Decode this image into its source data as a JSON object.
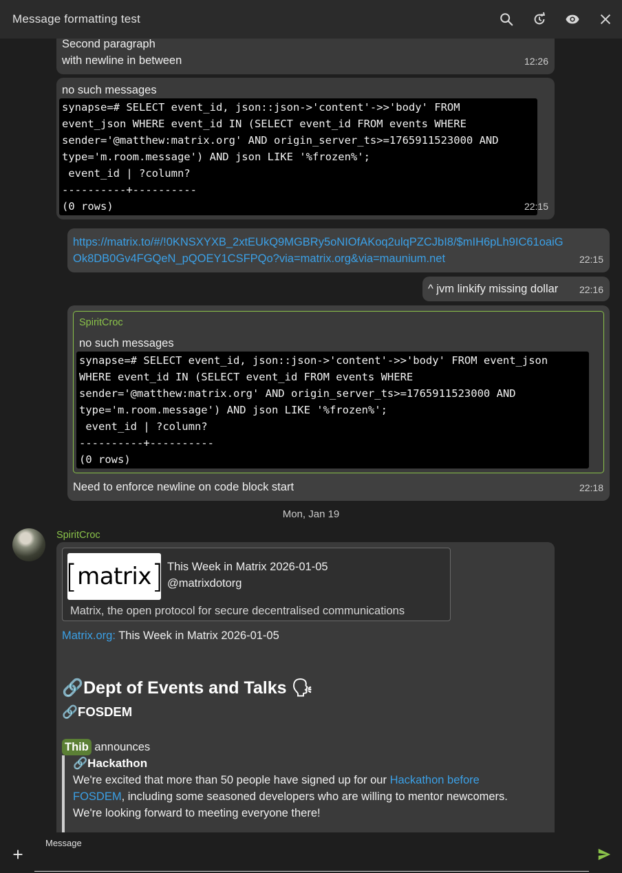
{
  "header": {
    "title": "Message formatting test",
    "icons": [
      "search-icon",
      "history-icon",
      "eye-icon",
      "close-icon"
    ]
  },
  "messages": [
    {
      "text_lines": [
        "Second paragraph",
        "with newline in between"
      ],
      "time": "12:26"
    },
    {
      "intro": "no such messages",
      "code": "synapse=# SELECT event_id, json::json->'content'->>'body' FROM\nevent_json WHERE event_id IN (SELECT event_id FROM events WHERE\nsender='@matthew:matrix.org' AND origin_server_ts>=1765911523000 AND\ntype='m.room.message') AND json LIKE '%frozen%';\n event_id | ?column?\n----------+----------\n(0 rows)",
      "time": "22:15"
    },
    {
      "link_lines": [
        "https://matrix.to/#/!0KNSXYXB_2xtEUkQ9MGBRy5oNIOfAKoq2ulqPZCJbI8/$mIH6pLh9IC61oaiG",
        "Ok8DB0Gv4FGQeN_pQOEY1CSFPQo?via=matrix.org&via=maunium.net"
      ],
      "time": "22:15"
    },
    {
      "text": "^ jvm linkify missing dollar",
      "time": "22:16"
    },
    {
      "quote_sender": "SpiritCroc",
      "quote_intro": "no such messages",
      "quote_code": "synapse=# SELECT event_id, json::json->'content'->>'body' FROM event_json\nWHERE event_id IN (SELECT event_id FROM events WHERE\nsender='@matthew:matrix.org' AND origin_server_ts>=1765911523000 AND\ntype='m.room.message') AND json LIKE '%frozen%';\n event_id | ?column?\n----------+----------\n(0 rows)",
      "text": "Need to enforce newline on code block start",
      "time": "22:18"
    }
  ],
  "day_separator": "Mon, Jan 19",
  "last_message": {
    "sender": "SpiritCroc",
    "preview": {
      "logo_text": "matrix",
      "title": "This Week in Matrix 2026-01-05",
      "site": "@matrixdotorg",
      "description": "Matrix, the open protocol for secure decentralised communications"
    },
    "line1_link": "Matrix.org:",
    "line1_rest": " This Week in Matrix 2026-01-05",
    "heading1": "🔗Dept of Events and Talks 🗣",
    "heading2": "🔗FOSDEM",
    "announcer": "Thib",
    "announces": " announces",
    "quote_heading": "🔗Hackathon",
    "quote_text_1": "We're excited that more than 50 people have signed up for our ",
    "quote_link_1": "Hackathon before",
    "quote_link_2": "FOSDEM",
    "quote_text_2": ", including some seasoned developers who are willing to mentor newcomers.",
    "quote_text_3": "We're looking forward to meeting everyone there!"
  },
  "composer": {
    "label": "Message"
  },
  "colors": {
    "accent_green": "#8bc34a",
    "link_blue": "#3ba0e6",
    "bubble": "#3a3a3a",
    "code_bg": "#000000"
  }
}
